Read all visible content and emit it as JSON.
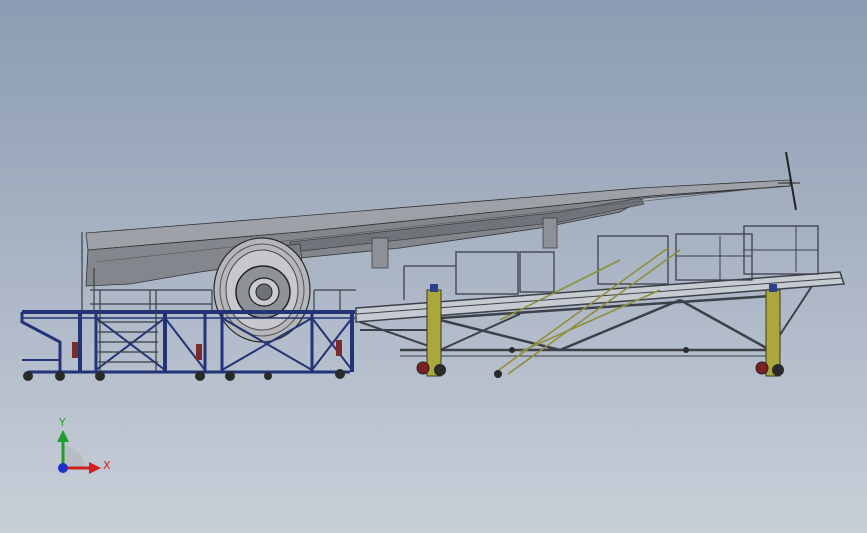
{
  "axes_triad": {
    "y_label": "Y",
    "x_label": "X",
    "colors": {
      "y": "#1e9e2e",
      "x": "#d21e1e",
      "z": "#1e32c8"
    }
  },
  "colors": {
    "background_top": "#8c9cb2",
    "background_bottom": "#c9cfd8",
    "wing_skin": "#8a8e94",
    "frame_blue": "#2c3e8c",
    "frame_steel": "#4c5058",
    "jack_yellow": "#aaa83c",
    "engine_nacelle": "#b4b6ba"
  }
}
